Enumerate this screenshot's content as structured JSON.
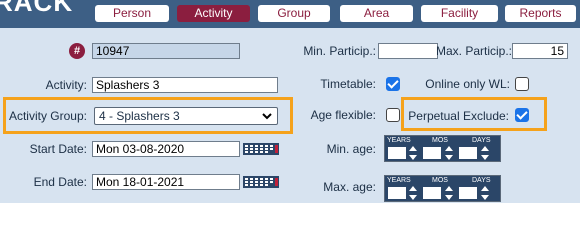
{
  "app": {
    "logo_text": "RACK"
  },
  "nav": {
    "tabs": [
      {
        "label": "Person",
        "active": false
      },
      {
        "label": "Activity",
        "active": true
      },
      {
        "label": "Group",
        "active": false
      },
      {
        "label": "Area",
        "active": false
      },
      {
        "label": "Facility",
        "active": false
      },
      {
        "label": "Reports",
        "active": false
      }
    ]
  },
  "form": {
    "id_badge": "#",
    "id_value": "10947",
    "activity_label": "Activity:",
    "activity_value": "Splashers 3",
    "activity_group_label": "Activity Group:",
    "activity_group_value": "4 - Splashers 3",
    "start_date_label": "Start Date:",
    "start_date_value": "Mon 03-08-2020",
    "end_date_label": "End Date:",
    "end_date_value": "Mon 18-01-2021",
    "min_particip_label": "Min. Particip.:",
    "min_particip_value": "",
    "max_particip_label": "Max. Particip.:",
    "max_particip_value": "15",
    "timetable_label": "Timetable:",
    "timetable_checked": true,
    "online_wl_label": "Online only WL:",
    "online_wl_checked": false,
    "age_flexible_label": "Age flexible:",
    "age_flexible_checked": false,
    "perpetual_exclude_label": "Perpetual Exclude:",
    "perpetual_exclude_checked": true,
    "min_age_label": "Min. age:",
    "max_age_label": "Max. age:",
    "age_units": [
      "YEARS",
      "MOS",
      "DAYS"
    ]
  },
  "colors": {
    "header_bg": "#3d5f85",
    "accent": "#8b1e3f",
    "panel_bg": "#d7e3f0",
    "highlight": "#f5a21b",
    "checkbox_on": "#1a73e8"
  }
}
